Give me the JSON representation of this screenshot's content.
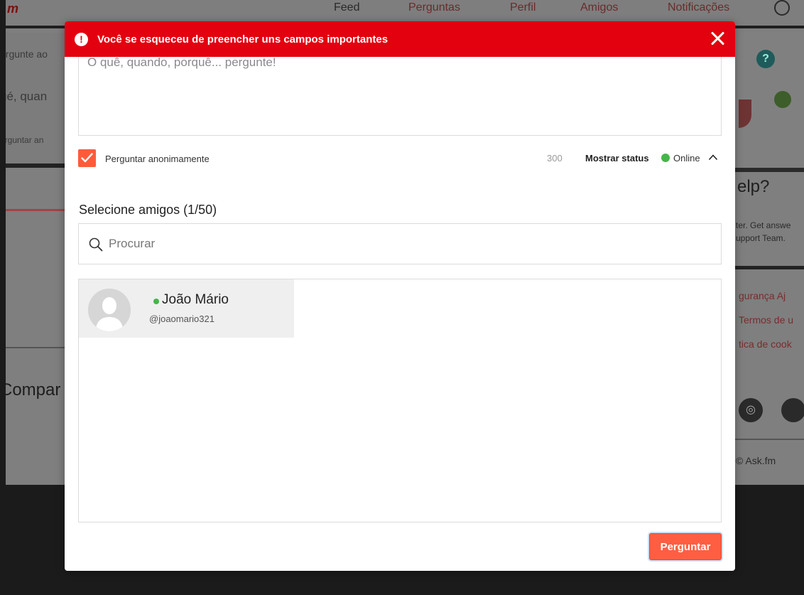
{
  "background": {
    "logo": "m",
    "nav": [
      "Feed",
      "Perguntas",
      "Perfil",
      "Amigos",
      "Notificações"
    ],
    "left_snippets": [
      "ergunte ao",
      "ué, quan",
      "erguntar an"
    ],
    "left_heading": "Compar",
    "right_heading": "elp?",
    "right_help_lines": [
      "ter. Get answe",
      "upport Team."
    ],
    "right_links": [
      "gurança  Aj",
      "Termos de u",
      "tica de cook"
    ],
    "copyright": "© Ask.fm"
  },
  "modal": {
    "error": {
      "icon": "exclamation-icon",
      "message": "Você se esqueceu de preencher uns campos importantes",
      "close_icon": "close-icon",
      "color": "#e3000f"
    },
    "question": {
      "placeholder": "O quê, quando, porquê... pergunte!",
      "value": ""
    },
    "options": {
      "anonymous_label": "Perguntar anonimamente",
      "anonymous_checked": true,
      "char_count": "300",
      "show_status_label": "Mostrar status",
      "status_value": "Online",
      "status_color": "#45b649"
    },
    "friends": {
      "title": "Selecione amigos (1/50)",
      "search_placeholder": "Procurar",
      "items": [
        {
          "name": "João Mário",
          "handle": "@joaomario321",
          "online": true
        }
      ]
    },
    "submit_label": "Perguntar",
    "accent_color": "#ff5e43"
  }
}
